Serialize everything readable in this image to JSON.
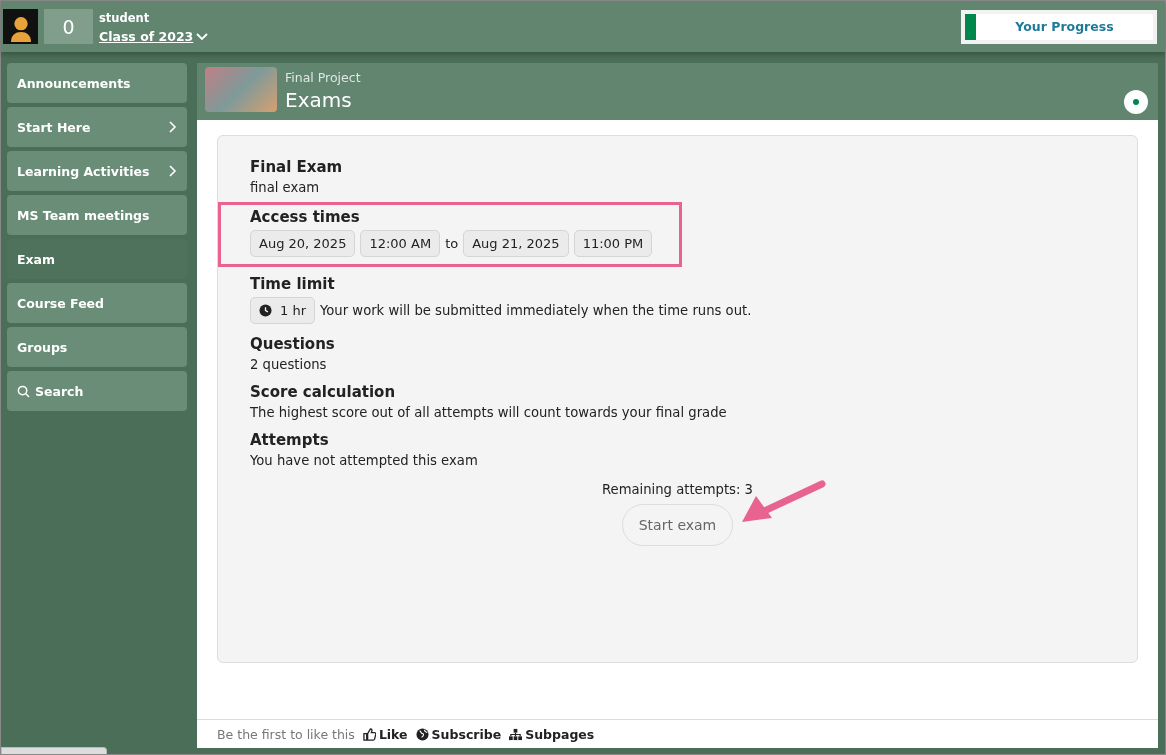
{
  "header": {
    "score": "0",
    "role": "student",
    "class_link": "Class of 2023",
    "progress_label": "Your Progress"
  },
  "sidebar": {
    "items": [
      {
        "label": "Announcements",
        "kind": "plain",
        "selected": false
      },
      {
        "label": "Start Here",
        "kind": "submenu",
        "selected": false
      },
      {
        "label": "Learning Activities",
        "kind": "submenu",
        "selected": false
      },
      {
        "label": "MS Team meetings",
        "kind": "plain",
        "selected": false
      },
      {
        "label": "Exam",
        "kind": "plain",
        "selected": true
      },
      {
        "label": "Course Feed",
        "kind": "plain",
        "selected": false
      },
      {
        "label": "Groups",
        "kind": "plain",
        "selected": false
      },
      {
        "label": "Search",
        "kind": "search",
        "selected": false
      }
    ]
  },
  "page": {
    "breadcrumb": "Final Project",
    "title": "Exams"
  },
  "exam": {
    "sections": [
      {
        "kind": "text",
        "heading": "Final Exam",
        "text": "final exam"
      },
      {
        "kind": "times",
        "heading": "Access times",
        "start_date": "Aug 20, 2025",
        "start_time": "12:00 AM",
        "separator": "to",
        "end_date": "Aug 21, 2025",
        "end_time": "11:00 PM",
        "highlighted": true
      },
      {
        "kind": "limit",
        "heading": "Time limit",
        "duration": "1 hr",
        "text": "Your work will be submitted immediately when the time runs out."
      },
      {
        "kind": "text",
        "heading": "Questions",
        "text": "2 questions"
      },
      {
        "kind": "text",
        "heading": "Score calculation",
        "text": "The highest score out of all attempts will count towards your final grade"
      },
      {
        "kind": "text",
        "heading": "Attempts",
        "text": "You have not attempted this exam"
      }
    ],
    "remaining": "Remaining attempts: 3",
    "start_button": "Start exam"
  },
  "footer": {
    "like_text": "Be the first to like this",
    "like": "Like",
    "subscribe": "Subscribe",
    "subpages": "Subpages"
  }
}
